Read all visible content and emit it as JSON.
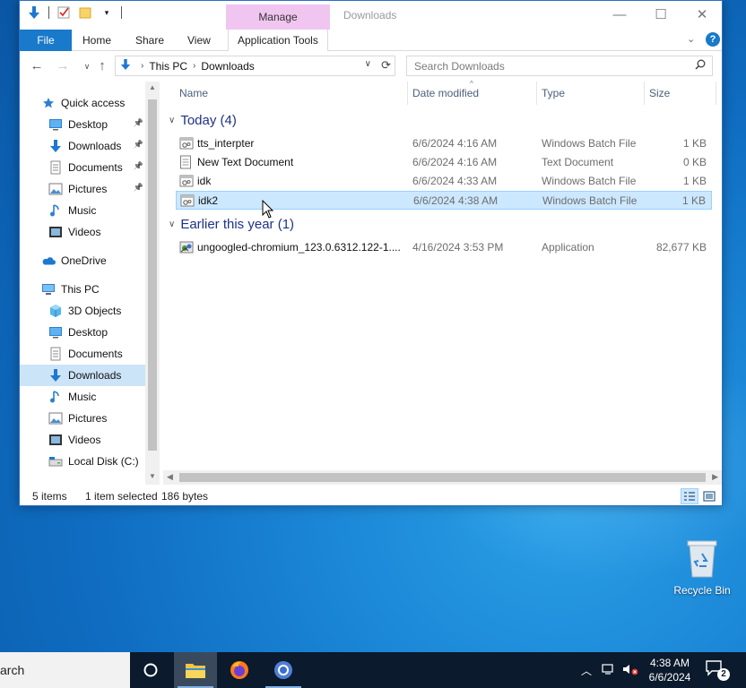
{
  "window": {
    "title": "Downloads",
    "context_tab": "Manage",
    "min_icon": "minimize-icon",
    "max_icon": "maximize-icon",
    "close_icon": "close-icon"
  },
  "ribbon": {
    "tabs": [
      "File",
      "Home",
      "Share",
      "View",
      "Application Tools"
    ],
    "help": "?"
  },
  "address": {
    "crumbs": [
      "This PC",
      "Downloads"
    ],
    "search_placeholder": "Search Downloads"
  },
  "nav_pane": {
    "items": [
      {
        "label": "Quick access",
        "icon": "star-icon",
        "indent": 0,
        "pinned": false
      },
      {
        "label": "Desktop",
        "icon": "desktop-folder-icon",
        "indent": 1,
        "pinned": true
      },
      {
        "label": "Downloads",
        "icon": "download-arrow-icon",
        "indent": 1,
        "pinned": true
      },
      {
        "label": "Documents",
        "icon": "documents-icon",
        "indent": 1,
        "pinned": true
      },
      {
        "label": "Pictures",
        "icon": "pictures-icon",
        "indent": 1,
        "pinned": true
      },
      {
        "label": "Music",
        "icon": "music-icon",
        "indent": 1,
        "pinned": false
      },
      {
        "label": "Videos",
        "icon": "videos-icon",
        "indent": 1,
        "pinned": false
      },
      {
        "label": "OneDrive",
        "icon": "cloud-icon",
        "indent": 0,
        "pinned": false
      },
      {
        "label": "This PC",
        "icon": "computer-icon",
        "indent": 0,
        "pinned": false
      },
      {
        "label": "3D Objects",
        "icon": "cube-icon",
        "indent": 1,
        "pinned": false
      },
      {
        "label": "Desktop",
        "icon": "desktop-folder-icon",
        "indent": 1,
        "pinned": false
      },
      {
        "label": "Documents",
        "icon": "documents-icon",
        "indent": 1,
        "pinned": false
      },
      {
        "label": "Downloads",
        "icon": "download-arrow-icon",
        "indent": 1,
        "pinned": false,
        "selected": true
      },
      {
        "label": "Music",
        "icon": "music-icon",
        "indent": 1,
        "pinned": false
      },
      {
        "label": "Pictures",
        "icon": "pictures-icon",
        "indent": 1,
        "pinned": false
      },
      {
        "label": "Videos",
        "icon": "videos-icon",
        "indent": 1,
        "pinned": false
      },
      {
        "label": "Local Disk (C:)",
        "icon": "drive-icon",
        "indent": 1,
        "pinned": false
      }
    ]
  },
  "file_list": {
    "columns": [
      "Name",
      "Date modified",
      "Type",
      "Size"
    ],
    "groups": [
      {
        "title": "Today (4)",
        "files": [
          {
            "name": "tts_interpter",
            "date": "6/6/2024 4:16 AM",
            "type": "Windows Batch File",
            "size": "1 KB",
            "icon": "batch-file-icon"
          },
          {
            "name": "New Text Document",
            "date": "6/6/2024 4:16 AM",
            "type": "Text Document",
            "size": "0 KB",
            "icon": "text-file-icon"
          },
          {
            "name": "idk",
            "date": "6/6/2024 4:33 AM",
            "type": "Windows Batch File",
            "size": "1 KB",
            "icon": "batch-file-icon"
          },
          {
            "name": "idk2",
            "date": "6/6/2024 4:38 AM",
            "type": "Windows Batch File",
            "size": "1 KB",
            "icon": "batch-file-icon",
            "selected": true
          }
        ]
      },
      {
        "title": "Earlier this year (1)",
        "files": [
          {
            "name": "ungoogled-chromium_123.0.6312.122-1....",
            "date": "4/16/2024 3:53 PM",
            "type": "Application",
            "size": "82,677 KB",
            "icon": "installer-icon"
          }
        ]
      }
    ]
  },
  "status": {
    "count": "5 items",
    "selection": "1 item selected",
    "size": "186 bytes"
  },
  "desktop": {
    "recycle_bin": "Recycle Bin"
  },
  "taskbar": {
    "search_text": "arch",
    "time": "4:38 AM",
    "date": "6/6/2024",
    "notifications": "2"
  },
  "colors": {
    "accent": "#1979ca",
    "selection": "#cce8ff",
    "manage_tab": "#f0c6f0",
    "taskbar": "#0b1a2c"
  }
}
